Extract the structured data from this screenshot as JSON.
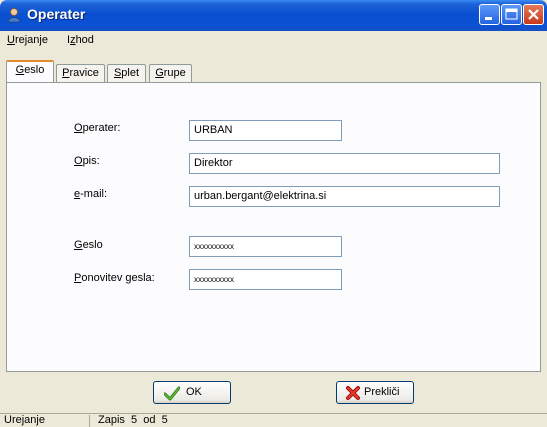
{
  "window": {
    "title": "Operater"
  },
  "menu": {
    "items": [
      {
        "pre": "",
        "ul": "U",
        "post": "rejanje"
      },
      {
        "pre": "I",
        "ul": "z",
        "post": "hod"
      }
    ]
  },
  "tabs": [
    {
      "pre": "",
      "ul": "G",
      "post": "eslo"
    },
    {
      "pre": "",
      "ul": "P",
      "post": "ravice"
    },
    {
      "pre": "",
      "ul": "S",
      "post": "plet"
    },
    {
      "pre": "",
      "ul": "G",
      "post": "rupe"
    }
  ],
  "form": {
    "operater": {
      "label_ul": "O",
      "label_post": "perater:",
      "value": "URBAN"
    },
    "opis": {
      "label_ul": "O",
      "label_post": "pis:",
      "value": "Direktor"
    },
    "email": {
      "label_ul": "e",
      "label_post": "-mail:",
      "value": "urban.bergant@elektrina.si"
    },
    "geslo": {
      "label_ul": "G",
      "label_post": "eslo",
      "value": "xxxxxxxxxx"
    },
    "ponovitev": {
      "label_ul": "P",
      "label_post": "onovitev gesla:",
      "value": "xxxxxxxxxx"
    }
  },
  "buttons": {
    "ok": {
      "label": "OK",
      "icon": "checkmark-icon"
    },
    "cancel": {
      "label": "Prekliči",
      "icon": "red-x-icon"
    }
  },
  "status": {
    "mode": "Urejanje",
    "record": "Zapis  5  od  5"
  },
  "colors": {
    "titlebar": "#0A4FD0",
    "tab_highlight": "#E68B2C",
    "background": "#ECE9D8"
  }
}
